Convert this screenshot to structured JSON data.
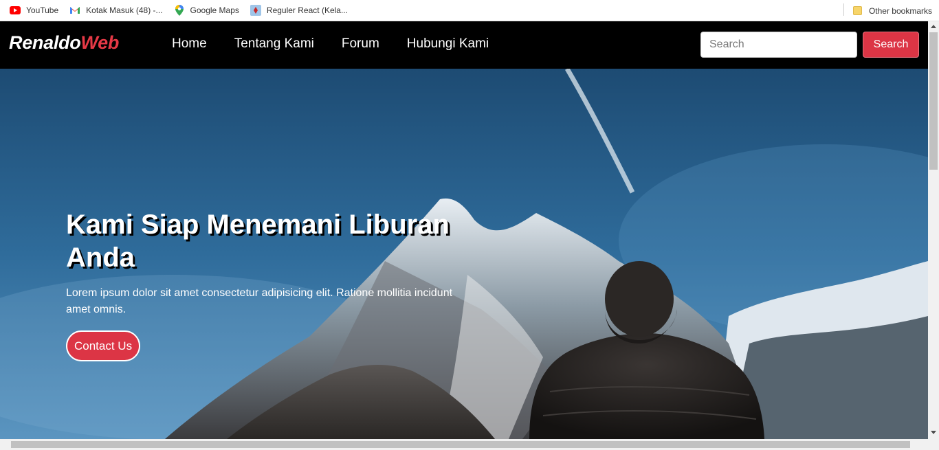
{
  "bookmarks": [
    {
      "label": "YouTube",
      "icon": "youtube-icon"
    },
    {
      "label": "Kotak Masuk (48) -...",
      "icon": "gmail-icon"
    },
    {
      "label": "Google Maps",
      "icon": "maps-pin-icon"
    },
    {
      "label": "Reguler React (Kela...",
      "icon": "react-course-icon"
    }
  ],
  "other_bookmarks": "Other bookmarks",
  "navbar": {
    "brand_part1": "Renaldo",
    "brand_part2": "Web",
    "links": [
      "Home",
      "Tentang Kami",
      "Forum",
      "Hubungi Kami"
    ],
    "search_placeholder": "Search",
    "search_button": "Search"
  },
  "hero": {
    "title": "Kami Siap Menemani Liburan Anda",
    "text": "Lorem ipsum dolor sit amet consectetur adipisicing elit. Ratione mollitia incidunt amet omnis.",
    "button": "Contact Us"
  },
  "colors": {
    "accent": "#dc3545",
    "navbar_bg": "#000000",
    "brand_accent": "#e63946"
  }
}
